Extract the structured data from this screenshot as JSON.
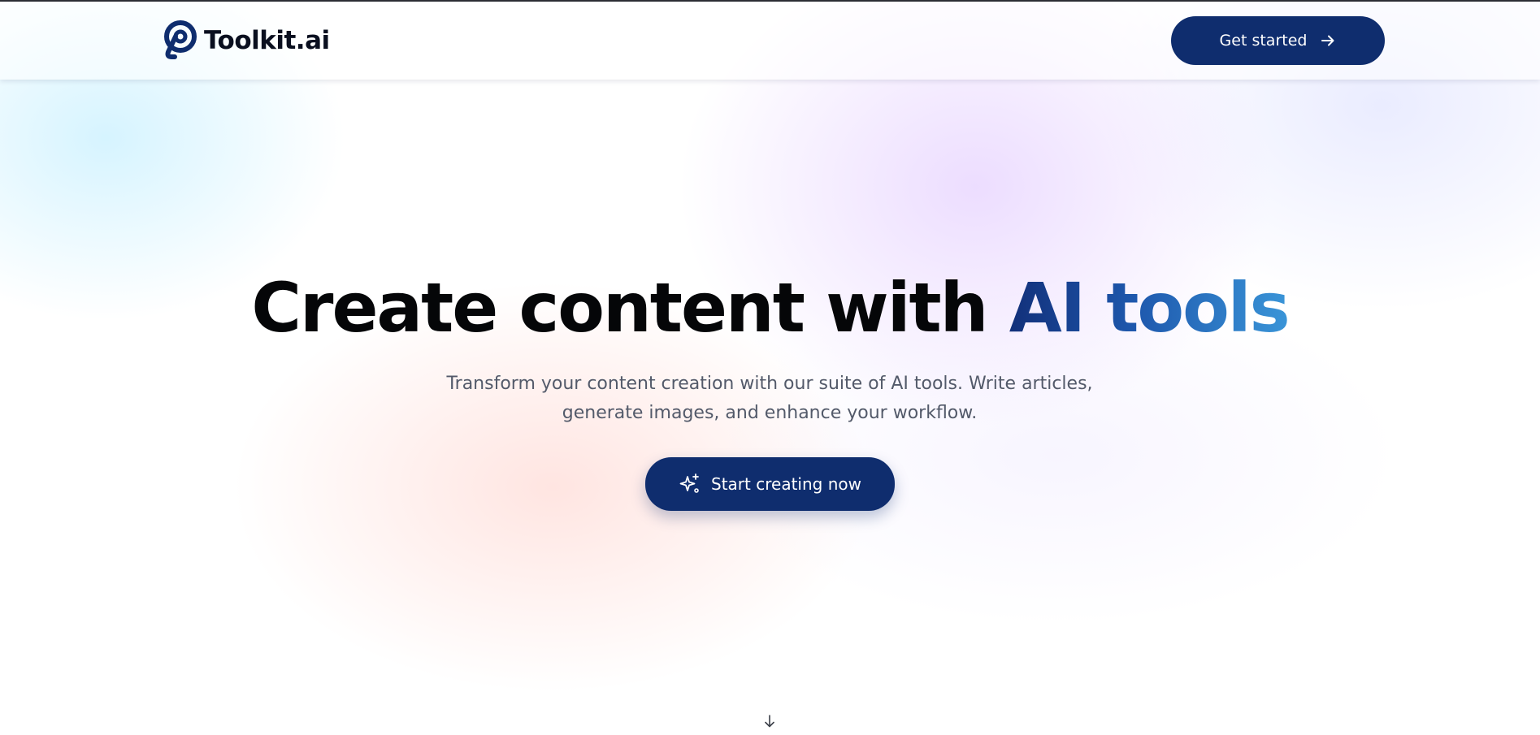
{
  "header": {
    "logo_text": "Toolkit.ai",
    "logo_icon": "toolkit-logo-icon",
    "cta_label": "Get started",
    "cta_icon": "arrow-right-icon"
  },
  "hero": {
    "title_main": "Create content with ",
    "title_accent": "AI tools",
    "subtitle_line1": "Transform your content creation with our suite of AI tools. Write articles,",
    "subtitle_line2": "generate images, and enhance your workflow.",
    "cta_label": "Start creating now",
    "cta_icon": "sparkles-icon",
    "scroll_icon": "arrow-down-icon"
  },
  "colors": {
    "primary": "#0f2d6e",
    "accent_start": "#12307a",
    "accent_end": "#3a95d8",
    "text_dark": "#050608",
    "text_muted": "#535a6a"
  }
}
